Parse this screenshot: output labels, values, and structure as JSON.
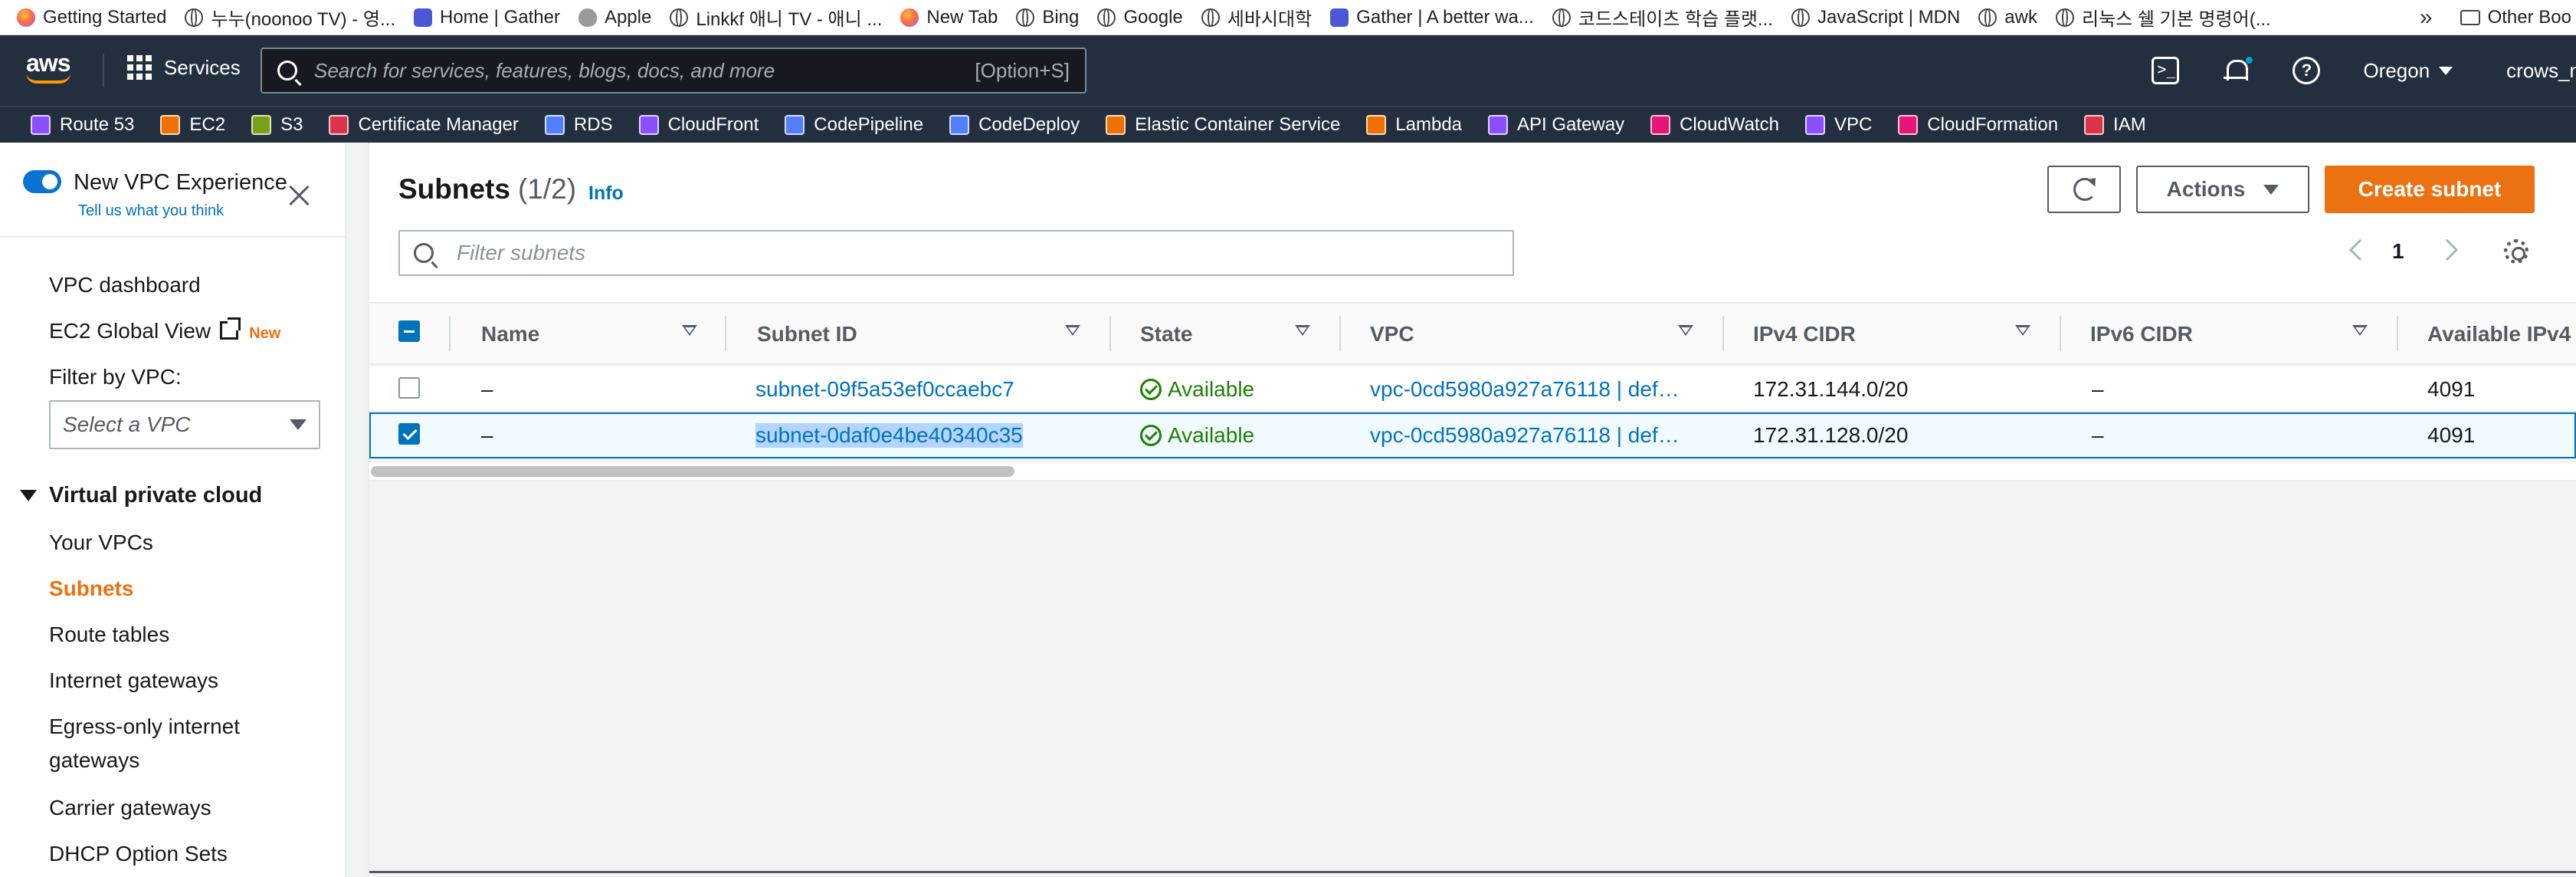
{
  "bookmarks": [
    {
      "label": "Getting Started",
      "icon": "firefox-icon"
    },
    {
      "label": "누누(noonoo TV) - 영...",
      "icon": "globe-icon"
    },
    {
      "label": "Home | Gather",
      "icon": "gather-icon"
    },
    {
      "label": "Apple",
      "icon": "apple-icon"
    },
    {
      "label": "Linkkf 애니 TV - 애니 ...",
      "icon": "globe-icon"
    },
    {
      "label": "New Tab",
      "icon": "firefox-icon"
    },
    {
      "label": "Bing",
      "icon": "globe-icon"
    },
    {
      "label": "Google",
      "icon": "globe-icon"
    },
    {
      "label": "세바시대학",
      "icon": "globe-icon"
    },
    {
      "label": "Gather | A better wa...",
      "icon": "gather-icon"
    },
    {
      "label": "코드스테이츠 학습 플랫...",
      "icon": "globe-icon"
    },
    {
      "label": "JavaScript | MDN",
      "icon": "globe-icon"
    },
    {
      "label": "awk",
      "icon": "globe-icon"
    },
    {
      "label": "리눅스 쉘 기본 명령어(...",
      "icon": "globe-icon"
    }
  ],
  "other_bookmarks": "Other Boo",
  "topnav": {
    "logo": "aws",
    "services": "Services",
    "search_placeholder": "Search for services, features, blogs, docs, and more",
    "search_shortcut": "[Option+S]",
    "region": "Oregon",
    "account": "crows_n"
  },
  "favorites": [
    {
      "label": "Route 53",
      "color": "#8c4fff"
    },
    {
      "label": "EC2",
      "color": "#ed7100"
    },
    {
      "label": "S3",
      "color": "#7aa116"
    },
    {
      "label": "Certificate Manager",
      "color": "#dd344c"
    },
    {
      "label": "RDS",
      "color": "#527fff"
    },
    {
      "label": "CloudFront",
      "color": "#8c4fff"
    },
    {
      "label": "CodePipeline",
      "color": "#527fff"
    },
    {
      "label": "CodeDeploy",
      "color": "#527fff"
    },
    {
      "label": "Elastic Container Service",
      "color": "#ed7100"
    },
    {
      "label": "Lambda",
      "color": "#ed7100"
    },
    {
      "label": "API Gateway",
      "color": "#8c4fff"
    },
    {
      "label": "CloudWatch",
      "color": "#e7157b"
    },
    {
      "label": "VPC",
      "color": "#8c4fff"
    },
    {
      "label": "CloudFormation",
      "color": "#e7157b"
    },
    {
      "label": "IAM",
      "color": "#dd344c"
    }
  ],
  "sidebar": {
    "toggle_label": "New VPC Experience",
    "toggle_sub": "Tell us what you think",
    "dashboard": "VPC dashboard",
    "global_view": "EC2 Global View",
    "new_badge": "New",
    "filter_label": "Filter by VPC:",
    "filter_placeholder": "Select a VPC",
    "section": "Virtual private cloud",
    "items": [
      "Your VPCs",
      "Subnets",
      "Route tables",
      "Internet gateways",
      "Egress-only internet",
      "gateways",
      "Carrier gateways",
      "DHCP Option Sets"
    ],
    "active": "Subnets"
  },
  "page": {
    "title": "Subnets",
    "count": "(1/2)",
    "info": "Info",
    "actions": "Actions",
    "create": "Create subnet",
    "filter_placeholder": "Filter subnets",
    "page_number": "1"
  },
  "table": {
    "columns": [
      "Name",
      "Subnet ID",
      "State",
      "VPC",
      "IPv4 CIDR",
      "IPv6 CIDR",
      "Available IPv4"
    ],
    "rows": [
      {
        "name": "–",
        "subnet_id": "subnet-09f5a53ef0ccaebc7",
        "state": "Available",
        "vpc": "vpc-0cd5980a927a76118 | def…",
        "ipv4": "172.31.144.0/20",
        "ipv6": "–",
        "available": "4091",
        "selected": false
      },
      {
        "name": "–",
        "subnet_id": "subnet-0daf0e4be40340c35",
        "state": "Available",
        "vpc": "vpc-0cd5980a927a76118 | def…",
        "ipv4": "172.31.128.0/20",
        "ipv6": "–",
        "available": "4091",
        "selected": true
      }
    ]
  }
}
